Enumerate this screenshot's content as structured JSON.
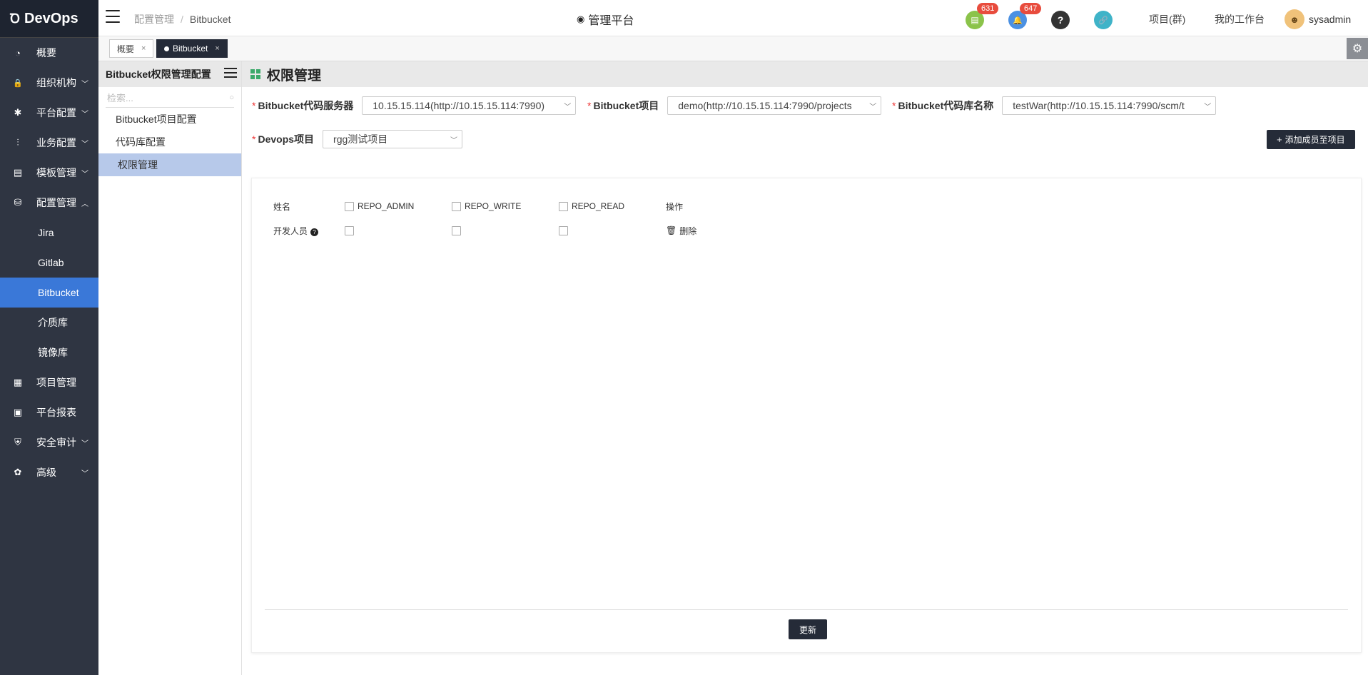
{
  "app": {
    "logo_mark": "Ꝺ",
    "name": "DevOps"
  },
  "sidebar": {
    "items": [
      {
        "label": "概要",
        "icon": "dashboard-icon",
        "glyph": "◔",
        "chevron": ""
      },
      {
        "label": "组织机构",
        "icon": "lock-icon",
        "glyph": "🔒",
        "chevron": "﹀"
      },
      {
        "label": "平台配置",
        "icon": "gear-icon",
        "glyph": "✱",
        "chevron": "﹀"
      },
      {
        "label": "业务配置",
        "icon": "sliders-icon",
        "glyph": "⫶",
        "chevron": "﹀"
      },
      {
        "label": "模板管理",
        "icon": "template-icon",
        "glyph": "▤",
        "chevron": "﹀"
      },
      {
        "label": "配置管理",
        "icon": "database-icon",
        "glyph": "⛁",
        "chevron": "︿"
      },
      {
        "label": "Jira"
      },
      {
        "label": "Gitlab"
      },
      {
        "label": "Bitbucket"
      },
      {
        "label": "介质库"
      },
      {
        "label": "镜像库"
      },
      {
        "label": "项目管理",
        "icon": "grid-icon",
        "glyph": "▦",
        "chevron": ""
      },
      {
        "label": "平台报表",
        "icon": "monitor-icon",
        "glyph": "▣",
        "chevron": ""
      },
      {
        "label": "安全审计",
        "icon": "shield-icon",
        "glyph": "⛨",
        "chevron": "﹀"
      },
      {
        "label": "高级",
        "icon": "advanced-icon",
        "glyph": "✿",
        "chevron": "﹀"
      }
    ]
  },
  "topbar": {
    "breadcrumb": [
      "配置管理",
      "Bitbucket"
    ],
    "breadcrumb_sep": "/",
    "title": "管理平台",
    "eye_glyph": "◉",
    "badges": {
      "todo_count": "631",
      "notify_count": "647"
    },
    "icons": {
      "todo": "▤",
      "bell": "🔔",
      "help": "?",
      "link": "🔗"
    },
    "links": {
      "projects": "项目(群)",
      "workspace": "我的工作台"
    },
    "user": {
      "name": "sysadmin",
      "avatar_glyph": "☻"
    },
    "colors": {
      "todo": "#8bc34a",
      "bell": "#4a90e2",
      "help": "#333333",
      "link": "#3fb3c8"
    }
  },
  "tabs": [
    {
      "label": "概要",
      "close": "×"
    },
    {
      "label": "Bitbucket",
      "close": "×"
    }
  ],
  "gear_glyph": "⚙",
  "subpanel": {
    "title": "Bitbucket权限管理配置",
    "search_placeholder": "检索...",
    "search_icon": "○",
    "items": [
      "Bitbucket项目配置",
      "代码库配置",
      "权限管理"
    ]
  },
  "main": {
    "title": "权限管理",
    "required_mark": "*",
    "fields": {
      "server": {
        "label": "Bitbucket代码服务器",
        "value": "10.15.15.114(http://10.15.15.114:7990)"
      },
      "project": {
        "label": "Bitbucket项目",
        "value": "demo(http://10.15.15.114:7990/projects"
      },
      "repo": {
        "label": "Bitbucket代码库名称",
        "value": "testWar(http://10.15.15.114:7990/scm/t"
      },
      "devops": {
        "label": "Devops项目",
        "value": "rgg测试项目"
      }
    },
    "select_arrow": "﹀",
    "add_button": {
      "plus": "+",
      "label": "添加成员至项目"
    },
    "table": {
      "headers": {
        "name": "姓名",
        "admin": "REPO_ADMIN",
        "write": "REPO_WRITE",
        "read": "REPO_READ",
        "op": "操作"
      },
      "rows": [
        {
          "name": "开发人员",
          "help": "?",
          "delete_icon": "🗑",
          "delete_label": "删除"
        }
      ]
    },
    "update_button": "更新"
  }
}
